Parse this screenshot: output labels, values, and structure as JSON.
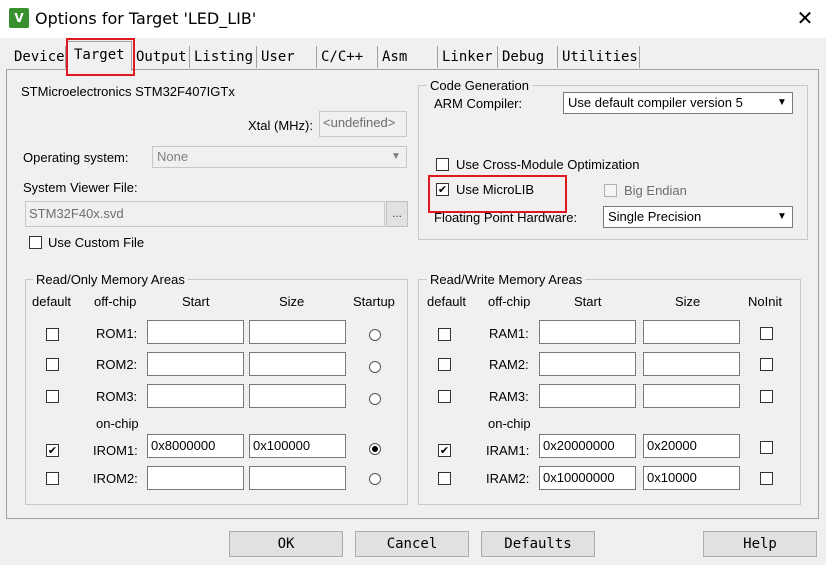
{
  "window": {
    "title": "Options for Target 'LED_LIB'",
    "icon": "keil-uvision-icon",
    "close": "✕"
  },
  "tabs": [
    "Device",
    "Target",
    "Output",
    "Listing",
    "User",
    "C/C++",
    "Asm",
    "Linker",
    "Debug",
    "Utilities"
  ],
  "active_tab": "Target",
  "target": {
    "device_name": "STMicroelectronics STM32F407IGTx",
    "xtal_label": "Xtal (MHz):",
    "xtal_value": "<undefined>",
    "os_label": "Operating system:",
    "os_value": "None",
    "svd_label": "System Viewer File:",
    "svd_value": "STM32F40x.svd",
    "svd_browse": "...",
    "custom_file_label": "Use Custom File"
  },
  "code_gen": {
    "legend": "Code Generation",
    "compiler_label": "ARM Compiler:",
    "compiler_value": "Use default compiler version 5",
    "cross_module_label": "Use Cross-Module Optimization",
    "microlib_label": "Use MicroLIB",
    "microlib_checked": true,
    "big_endian_label": "Big Endian",
    "fph_label": "Floating Point Hardware:",
    "fph_value": "Single Precision"
  },
  "rom": {
    "legend": "Read/Only Memory Areas",
    "headers": {
      "default": "default",
      "offchip": "off-chip",
      "start": "Start",
      "size": "Size",
      "startup": "Startup"
    },
    "onchip_label": "on-chip",
    "rows": [
      {
        "name": "ROM1:",
        "start": "",
        "size": "",
        "default": false,
        "startup": false
      },
      {
        "name": "ROM2:",
        "start": "",
        "size": "",
        "default": false,
        "startup": false
      },
      {
        "name": "ROM3:",
        "start": "",
        "size": "",
        "default": false,
        "startup": false
      },
      {
        "name": "IROM1:",
        "start": "0x8000000",
        "size": "0x100000",
        "default": true,
        "startup": true
      },
      {
        "name": "IROM2:",
        "start": "",
        "size": "",
        "default": false,
        "startup": false
      }
    ]
  },
  "ram": {
    "legend": "Read/Write Memory Areas",
    "headers": {
      "default": "default",
      "offchip": "off-chip",
      "start": "Start",
      "size": "Size",
      "noinit": "NoInit"
    },
    "onchip_label": "on-chip",
    "rows": [
      {
        "name": "RAM1:",
        "start": "",
        "size": "",
        "default": false,
        "noinit": false
      },
      {
        "name": "RAM2:",
        "start": "",
        "size": "",
        "default": false,
        "noinit": false
      },
      {
        "name": "RAM3:",
        "start": "",
        "size": "",
        "default": false,
        "noinit": false
      },
      {
        "name": "IRAM1:",
        "start": "0x20000000",
        "size": "0x20000",
        "default": true,
        "noinit": false
      },
      {
        "name": "IRAM2:",
        "start": "0x10000000",
        "size": "0x10000",
        "default": false,
        "noinit": false
      }
    ]
  },
  "buttons": {
    "ok": "OK",
    "cancel": "Cancel",
    "defaults": "Defaults",
    "help": "Help"
  },
  "colors": {
    "highlight": "#e0191f",
    "background": "#f0f0f0"
  }
}
